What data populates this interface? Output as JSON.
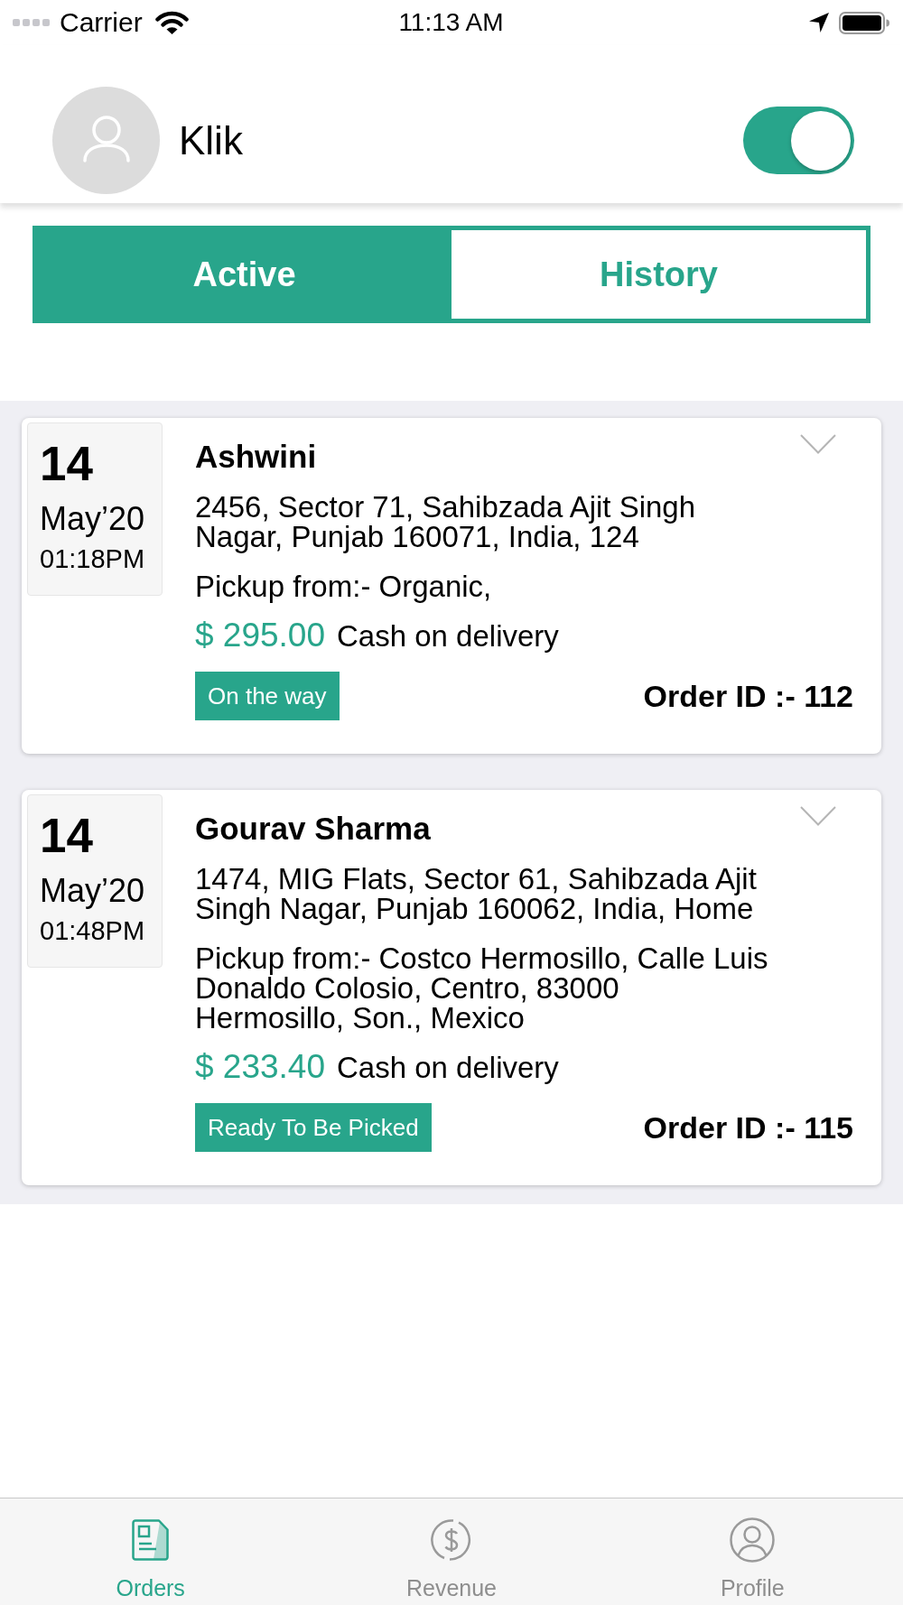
{
  "status_bar": {
    "carrier": "Carrier",
    "time": "11:13 AM"
  },
  "header": {
    "user_name": "Klik",
    "online_toggle": {
      "on": true
    }
  },
  "tabs": [
    {
      "label": "Active",
      "selected": true
    },
    {
      "label": "History",
      "selected": false
    }
  ],
  "orders": [
    {
      "day": "14",
      "month": "May’20",
      "time": "01:18PM",
      "customer": "Ashwini",
      "address": "2456, Sector 71, Sahibzada Ajit Singh Nagar, Punjab 160071, India, 124",
      "pickup": "Pickup from:- Organic,",
      "amount": "$ 295.00",
      "payment": "Cash on delivery",
      "status": "On the way",
      "order_id": "Order ID :- 112"
    },
    {
      "day": "14",
      "month": "May’20",
      "time": "01:48PM",
      "customer": "Gourav Sharma",
      "address": "1474, MIG Flats, Sector 61, Sahibzada Ajit Singh Nagar, Punjab 160062, India, Home",
      "pickup": "Pickup from:- Costco Hermosillo, Calle Luis Donaldo Colosio, Centro, 83000 Hermosillo, Son., Mexico",
      "amount": "$ 233.40",
      "payment": "Cash on delivery",
      "status": "Ready To Be Picked",
      "order_id": "Order ID :- 115"
    }
  ],
  "bottom_nav": [
    {
      "label": "Orders",
      "selected": true
    },
    {
      "label": "Revenue",
      "selected": false
    },
    {
      "label": "Profile",
      "selected": false
    }
  ]
}
